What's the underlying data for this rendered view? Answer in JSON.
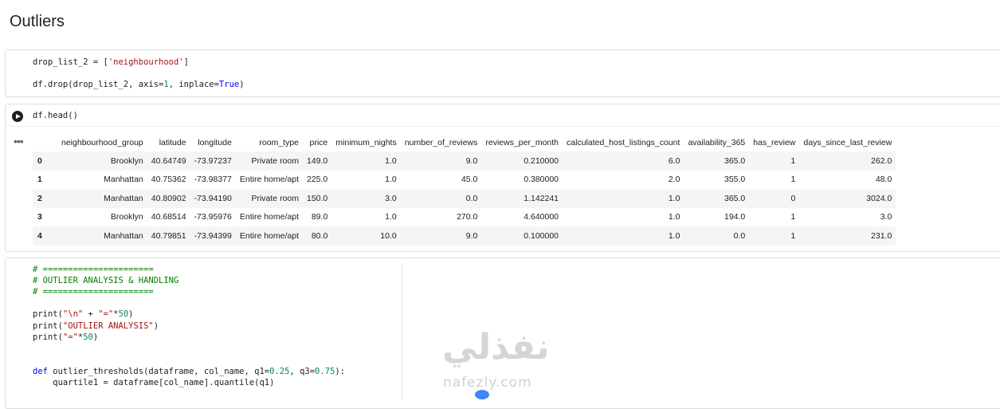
{
  "section_title": "Outliers",
  "cell1": {
    "line1": {
      "a": "drop_list_2 = [",
      "s": "'neighbourhood'",
      "b": "]"
    },
    "line2": {
      "a": "df.drop(drop_list_2, axis=",
      "n": "1",
      "b": ", inplace=",
      "k": "True",
      "c": ")"
    }
  },
  "cell2": {
    "code": "df.head()",
    "table": {
      "columns": [
        "",
        "neighbourhood_group",
        "latitude",
        "longitude",
        "room_type",
        "price",
        "minimum_nights",
        "number_of_reviews",
        "reviews_per_month",
        "calculated_host_listings_count",
        "availability_365",
        "has_review",
        "days_since_last_review"
      ],
      "rows": [
        [
          "0",
          "Brooklyn",
          "40.64749",
          "-73.97237",
          "Private room",
          "149.0",
          "1.0",
          "9.0",
          "0.210000",
          "6.0",
          "365.0",
          "1",
          "262.0"
        ],
        [
          "1",
          "Manhattan",
          "40.75362",
          "-73.98377",
          "Entire home/apt",
          "225.0",
          "1.0",
          "45.0",
          "0.380000",
          "2.0",
          "355.0",
          "1",
          "48.0"
        ],
        [
          "2",
          "Manhattan",
          "40.80902",
          "-73.94190",
          "Private room",
          "150.0",
          "3.0",
          "0.0",
          "1.142241",
          "1.0",
          "365.0",
          "0",
          "3024.0"
        ],
        [
          "3",
          "Brooklyn",
          "40.68514",
          "-73.95976",
          "Entire home/apt",
          "89.0",
          "1.0",
          "270.0",
          "4.640000",
          "1.0",
          "194.0",
          "1",
          "3.0"
        ],
        [
          "4",
          "Manhattan",
          "40.79851",
          "-73.94399",
          "Entire home/apt",
          "80.0",
          "10.0",
          "9.0",
          "0.100000",
          "1.0",
          "0.0",
          "1",
          "231.0"
        ]
      ]
    }
  },
  "cell3": {
    "comment1": "# ======================",
    "comment2": "# OUTLIER ANALYSIS & HANDLING",
    "comment3": "# ======================",
    "print1": {
      "a": "print(",
      "s1": "\"\\n\"",
      "b": " + ",
      "s2": "\"=\"",
      "c": "*",
      "n": "50",
      "d": ")"
    },
    "print2": {
      "a": "print(",
      "s": "\"OUTLIER ANALYSIS\"",
      "b": ")"
    },
    "print3": {
      "a": "print(",
      "s": "\"=\"",
      "c": "*",
      "n": "50",
      "d": ")"
    },
    "def_line": {
      "k": "def",
      "a": " outlier_thresholds(dataframe, col_name, q1=",
      "n1": "0.25",
      "b": ", q3=",
      "n2": "0.75",
      "c": "):"
    },
    "quartile_line": "    quartile1 = dataframe[col_name].quantile(q1)"
  },
  "watermark": {
    "arabic": "نفذلي",
    "latin": "nafezly.com"
  }
}
